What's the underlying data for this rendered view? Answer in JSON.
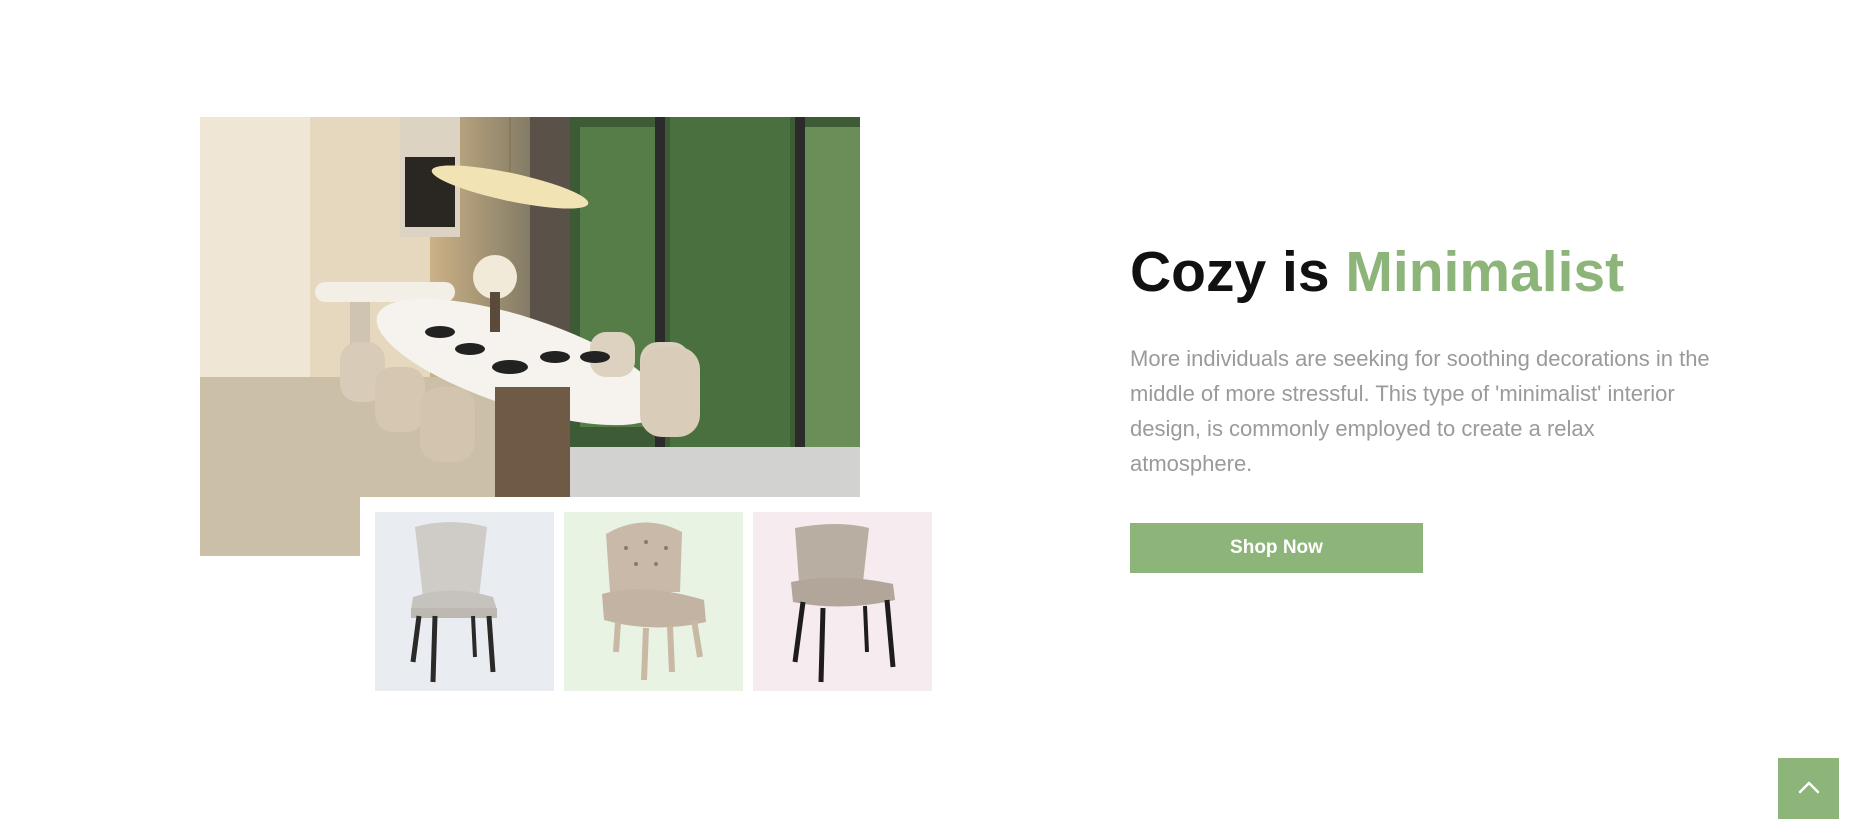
{
  "section": {
    "headline_prefix": "Cozy is ",
    "headline_accent": "Minimalist",
    "description": "More individuals are seeking for soothing decorations in the middle of more stressful. This type of 'minimalist' interior design, is commonly employed to create a relax atmosphere.",
    "cta_label": "Shop Now"
  },
  "thumbnails": [
    {
      "name": "gray-upholstered-chair",
      "background": "#e9ecf1"
    },
    {
      "name": "tufted-beige-chair",
      "background": "#e8f3e4"
    },
    {
      "name": "taupe-modern-chair",
      "background": "#f6ebee"
    }
  ],
  "colors": {
    "accent": "#8db57a",
    "text_dark": "#111111",
    "text_muted": "#9a9a9a"
  },
  "icons": {
    "back_to_top": "chevron-up-icon"
  }
}
